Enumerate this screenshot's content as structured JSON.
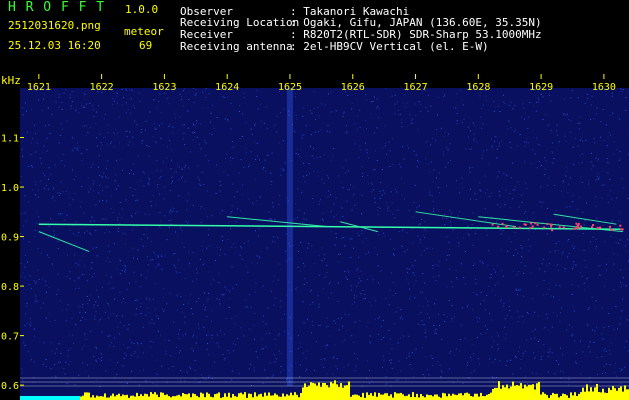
{
  "app": {
    "name": "H R O F F T",
    "version": "1.0.0"
  },
  "file": {
    "filename": "2512031620.png",
    "datetime": "25.12.03 16:20"
  },
  "meteor": {
    "label": "meteor",
    "count": "69"
  },
  "station": {
    "rows": [
      {
        "label": "Observer",
        "value": ": Takanori Kawachi"
      },
      {
        "label": "Receiving Location",
        "value": ": Ogaki, Gifu, JAPAN (136.60E, 35.35N)"
      },
      {
        "label": "Receiver",
        "value": ": R820T2(RTL-SDR) SDR-Sharp 53.1000MHz"
      },
      {
        "label": "Receiving antenna",
        "value": ": 2el-HB9CV Vertical (el. E-W)"
      }
    ]
  },
  "chart_data": {
    "type": "heatmap",
    "ylabel": "kHz",
    "x_ticks": [
      "1621",
      "1622",
      "1623",
      "1624",
      "1625",
      "1626",
      "1627",
      "1628",
      "1629",
      "1630"
    ],
    "y_ticks": [
      "1.1",
      "1.0",
      "0.9",
      "0.8",
      "0.7",
      "0.6"
    ],
    "x_range": [
      1620.7,
      1630.4
    ],
    "y_range": [
      0.57,
      1.2
    ],
    "carrier_khz": 0.925,
    "grid": false,
    "colors": {
      "background": "#0a1060",
      "noise": "#3060ff",
      "trace": "#33ffaa",
      "hot": "#ff4466",
      "baseline": "#ffffff",
      "power_fill": "#ffff00",
      "power_base": "#00ffff"
    }
  }
}
